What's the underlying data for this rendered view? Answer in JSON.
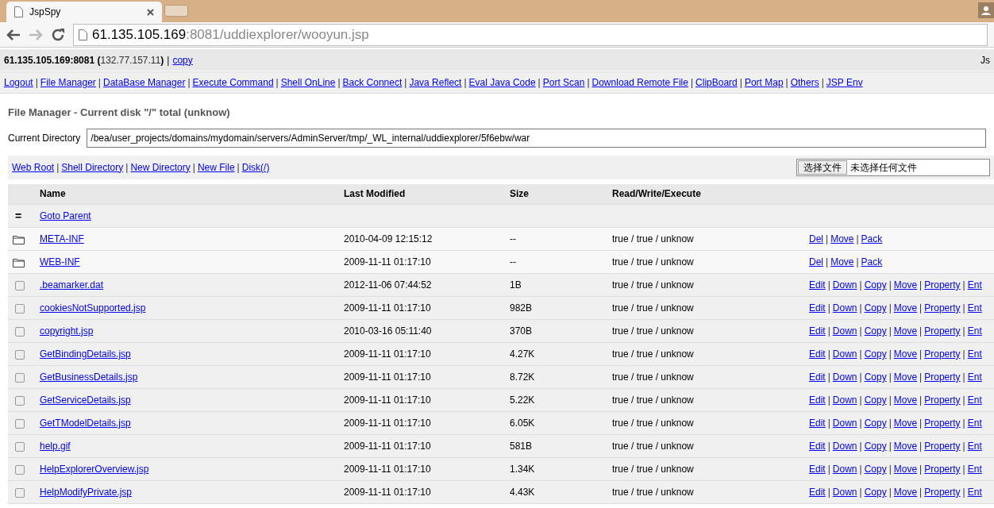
{
  "browser": {
    "tab_title": "JspSpy",
    "url_host": "61.135.105.169",
    "url_rest": ":8081/uddiexplorer/wooyun.jsp"
  },
  "header": {
    "host": "61.135.105.169:8081",
    "open_paren": "(",
    "ip": "132.77.157.11",
    "close_paren": ")",
    "separator": "|",
    "copy_link": "copy",
    "right_text": "Js"
  },
  "separator": "|",
  "nav": [
    "Logout",
    "File Manager",
    "DataBase Manager",
    "Execute Command",
    "Shell OnLine",
    "Back Connect",
    "Java Reflect",
    "Eval Java Code",
    "Port Scan",
    "Download Remote File",
    "ClipBoard",
    "Port Map",
    "Others",
    "JSP Env"
  ],
  "title": "File Manager - Current disk \"/\" total (unknow)",
  "current_directory": {
    "label": "Current Directory",
    "value": "/bea/user_projects/domains/mydomain/servers/AdminServer/tmp/_WL_internal/uddiexplorer/5f6ebw/war"
  },
  "toolbar": [
    "Web Root",
    "Shell Directory",
    "New Directory",
    "New File",
    "Disk(/)"
  ],
  "upload": {
    "button": "选择文件",
    "status": "未选择任何文件"
  },
  "table": {
    "columns": [
      "Name",
      "Last Modified",
      "Size",
      "Read/Write/Execute"
    ],
    "parent": {
      "symbol": "=",
      "label": "Goto Parent"
    },
    "rows": [
      {
        "kind": "folder",
        "name": "META-INF",
        "modified": "2010-04-09 12:15:12",
        "size": "--",
        "rwx": "true / true / unknow",
        "actions": [
          "Del",
          "Move",
          "Pack"
        ]
      },
      {
        "kind": "folder",
        "name": "WEB-INF",
        "modified": "2009-11-11 01:17:10",
        "size": "--",
        "rwx": "true / true / unknow",
        "actions": [
          "Del",
          "Move",
          "Pack"
        ]
      },
      {
        "kind": "file",
        "checked": false,
        "name": ".beamarker.dat",
        "modified": "2012-11-06 07:44:52",
        "size": "1B",
        "rwx": "true / true / unknow",
        "actions": [
          "Edit",
          "Down",
          "Copy",
          "Move",
          "Property",
          "Ent"
        ]
      },
      {
        "kind": "file",
        "checked": false,
        "name": "cookiesNotSupported.jsp",
        "modified": "2009-11-11 01:17:10",
        "size": "982B",
        "rwx": "true / true / unknow",
        "actions": [
          "Edit",
          "Down",
          "Copy",
          "Move",
          "Property",
          "Ent"
        ]
      },
      {
        "kind": "file",
        "checked": false,
        "name": "copyright.jsp",
        "modified": "2010-03-16 05:11:40",
        "size": "370B",
        "rwx": "true / true / unknow",
        "actions": [
          "Edit",
          "Down",
          "Copy",
          "Move",
          "Property",
          "Ent"
        ]
      },
      {
        "kind": "file",
        "checked": false,
        "name": "GetBindingDetails.jsp",
        "modified": "2009-11-11 01:17:10",
        "size": "4.27K",
        "rwx": "true / true / unknow",
        "actions": [
          "Edit",
          "Down",
          "Copy",
          "Move",
          "Property",
          "Ent"
        ]
      },
      {
        "kind": "file",
        "checked": false,
        "name": "GetBusinessDetails.jsp",
        "modified": "2009-11-11 01:17:10",
        "size": "8.72K",
        "rwx": "true / true / unknow",
        "actions": [
          "Edit",
          "Down",
          "Copy",
          "Move",
          "Property",
          "Ent"
        ]
      },
      {
        "kind": "file",
        "checked": false,
        "name": "GetServiceDetails.jsp",
        "modified": "2009-11-11 01:17:10",
        "size": "5.22K",
        "rwx": "true / true / unknow",
        "actions": [
          "Edit",
          "Down",
          "Copy",
          "Move",
          "Property",
          "Ent"
        ]
      },
      {
        "kind": "file",
        "checked": false,
        "name": "GetTModelDetails.jsp",
        "modified": "2009-11-11 01:17:10",
        "size": "6.05K",
        "rwx": "true / true / unknow",
        "actions": [
          "Edit",
          "Down",
          "Copy",
          "Move",
          "Property",
          "Ent"
        ]
      },
      {
        "kind": "file",
        "checked": false,
        "name": "help.gif",
        "modified": "2009-11-11 01:17:10",
        "size": "581B",
        "rwx": "true / true / unknow",
        "actions": [
          "Edit",
          "Down",
          "Copy",
          "Move",
          "Property",
          "Ent"
        ]
      },
      {
        "kind": "file",
        "checked": false,
        "name": "HelpExplorerOverview.jsp",
        "modified": "2009-11-11 01:17:10",
        "size": "1.34K",
        "rwx": "true / true / unknow",
        "actions": [
          "Edit",
          "Down",
          "Copy",
          "Move",
          "Property",
          "Ent"
        ]
      },
      {
        "kind": "file",
        "checked": false,
        "name": "HelpModifyPrivate.jsp",
        "modified": "2009-11-11 01:17:10",
        "size": "4.43K",
        "rwx": "true / true / unknow",
        "actions": [
          "Edit",
          "Down",
          "Copy",
          "Move",
          "Property",
          "Ent"
        ]
      }
    ]
  }
}
